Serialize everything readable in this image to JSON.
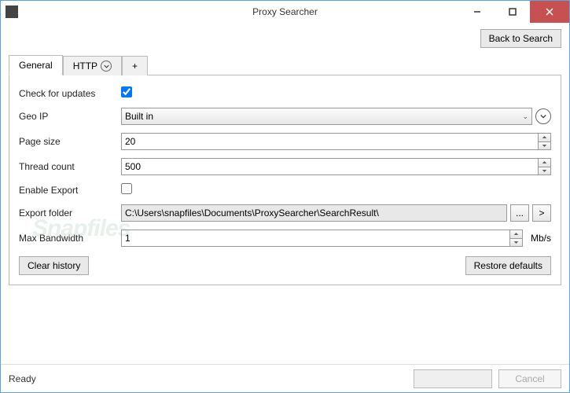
{
  "window": {
    "title": "Proxy Searcher"
  },
  "header": {
    "back_to_search": "Back to Search"
  },
  "tabs": {
    "general": "General",
    "http": "HTTP",
    "plus": "+"
  },
  "form": {
    "check_updates_label": "Check for updates",
    "check_updates_checked": true,
    "geoip_label": "Geo IP",
    "geoip_value": "Built in",
    "page_size_label": "Page size",
    "page_size_value": "20",
    "thread_count_label": "Thread count",
    "thread_count_value": "500",
    "enable_export_label": "Enable Export",
    "enable_export_checked": false,
    "export_folder_label": "Export folder",
    "export_folder_value": "C:\\Users\\snapfiles\\Documents\\ProxySearcher\\SearchResult\\",
    "browse_btn": "...",
    "go_btn": ">",
    "max_bandwidth_label": "Max Bandwidth",
    "max_bandwidth_value": "1",
    "max_bandwidth_unit": "Mb/s"
  },
  "actions": {
    "clear_history": "Clear history",
    "restore_defaults": "Restore defaults"
  },
  "status": {
    "text": "Ready",
    "cancel": "Cancel"
  },
  "watermark": "Snapfiles"
}
